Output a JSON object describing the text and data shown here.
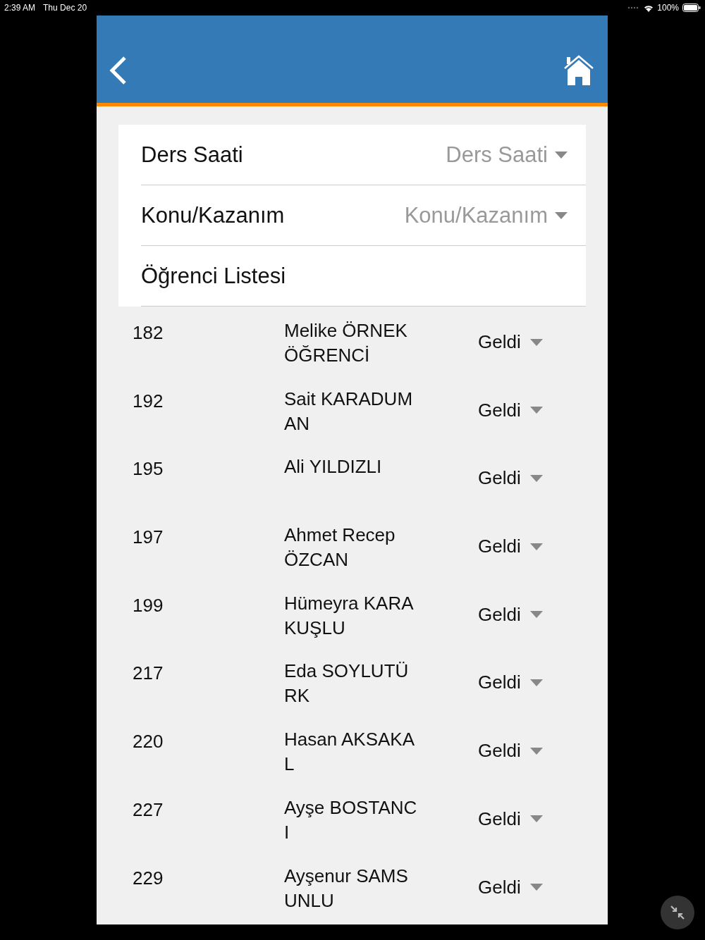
{
  "status_bar": {
    "time": "2:39 AM",
    "date": "Thu Dec 20",
    "battery": "100%"
  },
  "form": [
    {
      "kind": "select",
      "label": "Ders Saati",
      "placeholder": "Ders Saati"
    },
    {
      "kind": "select",
      "label": "Konu/Kazanım",
      "placeholder": "Konu/Kazanım"
    },
    {
      "kind": "heading",
      "label": "Öğrenci Listesi"
    }
  ],
  "students": [
    {
      "number": "182",
      "name": "Melike ÖRNEK\nÖĞRENCİ",
      "status": "Geldi"
    },
    {
      "number": "192",
      "name": "Sait KARADUM\nAN",
      "status": "Geldi"
    },
    {
      "number": "195",
      "name": "Ali YILDIZLI",
      "status": "Geldi"
    },
    {
      "number": "197",
      "name": "Ahmet Recep\nÖZCAN",
      "status": "Geldi"
    },
    {
      "number": "199",
      "name": "Hümeyra KARA\nKUŞLU",
      "status": "Geldi"
    },
    {
      "number": "217",
      "name": "Eda SOYLUTÜ\nRK",
      "status": "Geldi"
    },
    {
      "number": "220",
      "name": "Hasan AKSAKA\nL",
      "status": "Geldi"
    },
    {
      "number": "227",
      "name": "Ayşe BOSTANC\nI",
      "status": "Geldi"
    },
    {
      "number": "229",
      "name": "Ayşenur SAMS\nUNLU",
      "status": "Geldi"
    }
  ]
}
